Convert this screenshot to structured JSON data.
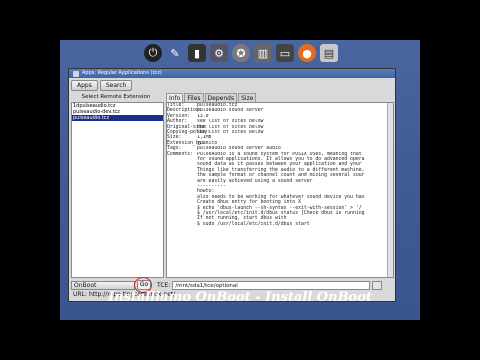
{
  "window": {
    "title": "Apps: Regular Applications (tcz)"
  },
  "toolbar": {
    "apps_label": "Apps",
    "search_label": "Search"
  },
  "left_panel": {
    "header": "Select Remote Extension",
    "items": [
      "1dpulseaudio.tcz",
      "pulseaudio-dev.tcz",
      "pulseaudio.tcz"
    ],
    "selected_index": 2
  },
  "tabs": [
    "Info",
    "Files",
    "Depends",
    "Size"
  ],
  "info": {
    "fields": [
      {
        "k": "Title:",
        "v": "pulseaudio.tcz"
      },
      {
        "k": "Description:",
        "v": "pulseaudio sound server"
      },
      {
        "k": "Version:",
        "v": "13.0"
      },
      {
        "k": "Author:",
        "v": "see list of sites below"
      },
      {
        "k": "Original-site:",
        "v": "see list of sites below"
      },
      {
        "k": "Copying-policy:",
        "v": "see list of sites below"
      },
      {
        "k": "Size:",
        "v": "1,1MB"
      },
      {
        "k": "Extension_by:",
        "v": "juanito"
      },
      {
        "k": "Tags:",
        "v": "pulseaudio sound server audio"
      },
      {
        "k": "Comments:",
        "v": "PulseAudio is a sound system for POSIX OSes, meaning that"
      }
    ],
    "comments": [
      "for sound applications. It allows you to do advanced opera",
      "sound data as it passes between your application and your",
      "Things like transferring the audio to a different machine,",
      "the sample format or channel count and mixing several sour",
      "are easily achieved using a sound server",
      "----------",
      "howto:",
      "also needs to be working for whatever sound device you hav",
      "Create dbus entry for booting into X",
      "$ echo  'dbus-launch --sh-syntax --exit-with-session' > '/",
      "$ /usr/local/etc/init.d/dbus status [Check dbus is running",
      "If not running, start dbus with",
      "$ sudo /usr/local/etc/init.d/dbus start"
    ]
  },
  "bottom": {
    "mode": "OnBoot",
    "go_label": "Go",
    "tce_label": "TCE:",
    "tce_path": "/mnt/sda1/tce/optional"
  },
  "url": {
    "label": "URL:",
    "value": "http://repo.tinycorelinux.net/"
  },
  "caption": "Installiamo OnBoot - Install OnBoot",
  "colors": {
    "desktop": "#4a66a0",
    "titlebar": "#3e63a4",
    "selection": "#1d2e8a",
    "highlight_ring": "#d82020"
  }
}
